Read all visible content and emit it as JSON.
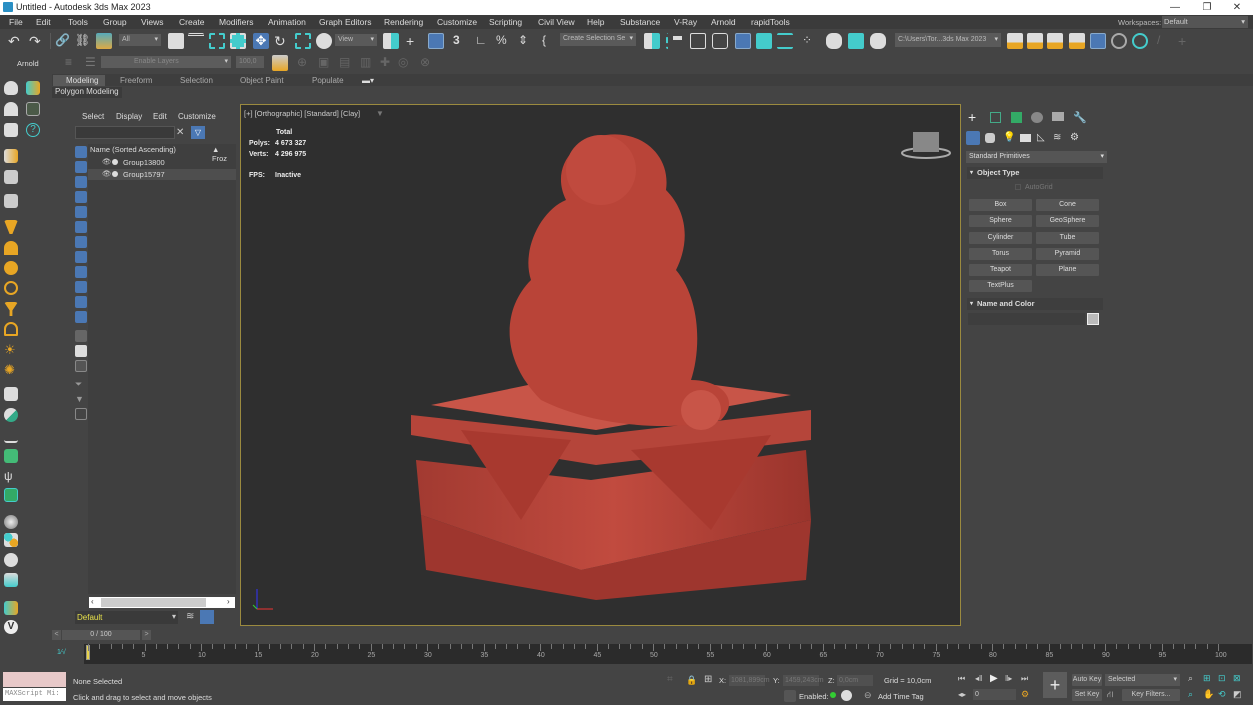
{
  "window": {
    "title": "Untitled - Autodesk 3ds Max 2023",
    "minimize": "—",
    "restore": "❐",
    "close": "✕"
  },
  "menu": [
    "File",
    "Edit",
    "Tools",
    "Group",
    "Views",
    "Create",
    "Modifiers",
    "Animation",
    "Graph Editors",
    "Rendering",
    "Customize",
    "Scripting",
    "Civil View",
    "Help",
    "Substance",
    "V-Ray",
    "Arnold",
    "rapidTools"
  ],
  "workspaces": {
    "label": "Workspaces:",
    "value": "Default"
  },
  "toolbar": {
    "selection_filter": "All",
    "ref_coord": "View",
    "named_selection": "Create Selection Se",
    "project_path": "C:\\Users\\Tor...3ds Max 2023",
    "arnold_label": "Arnold",
    "layer_dropdown": "Enable Layers",
    "layer_value": "100,0"
  },
  "ribbon": {
    "tabs": [
      "Modeling",
      "Freeform",
      "Selection",
      "Object Paint",
      "Populate"
    ],
    "active": "Modeling",
    "panel_label": "Polygon Modeling"
  },
  "scene_explorer": {
    "menu": [
      "Select",
      "Display",
      "Edit",
      "Customize"
    ],
    "search_value": "",
    "column_name": "Name (Sorted Ascending)",
    "column_frozen": "▲ Froz",
    "rows": [
      {
        "name": "Group13800"
      },
      {
        "name": "Group15797"
      }
    ],
    "layer": "Default"
  },
  "viewport": {
    "label": "[+] [Orthographic] [Standard] [Clay]",
    "stats": {
      "header": "Total",
      "polys_label": "Polys:",
      "polys": "4 673 327",
      "verts_label": "Verts:",
      "verts": "4 296 975",
      "fps_label": "FPS:",
      "fps": "Inactive"
    },
    "model_color": "#b8453a"
  },
  "command_panel": {
    "category": "Standard Primitives",
    "object_type_title": "Object Type",
    "autogrid": "AutoGrid",
    "buttons": [
      "Box",
      "Cone",
      "Sphere",
      "GeoSphere",
      "Cylinder",
      "Tube",
      "Torus",
      "Pyramid",
      "Teapot",
      "Plane",
      "TextPlus"
    ],
    "name_color_title": "Name and Color",
    "name_value": ""
  },
  "timeline": {
    "frame_display": "0 / 100",
    "current_frame": 0,
    "total_frames": 100,
    "ticks": [
      0,
      5,
      10,
      15,
      20,
      25,
      30,
      35,
      40,
      45,
      50,
      55,
      60,
      65,
      70,
      75,
      80,
      85,
      90,
      95,
      100
    ]
  },
  "status": {
    "maxscript": "MAXScript Mi:",
    "selection": "None Selected",
    "prompt": "Click and drag to select and move objects",
    "x_label": "X:",
    "x_value": "1081,899cm",
    "y_label": "Y:",
    "y_value": "1459,243cm",
    "z_label": "Z:",
    "z_value": "0,0cm",
    "grid": "Grid = 10,0cm",
    "enabled_label": "Enabled:",
    "add_time_tag": "Add Time Tag",
    "auto_key": "Auto Key",
    "set_key": "Set Key",
    "key_mode": "Selected",
    "key_filters": "Key Filters...",
    "frame_input": "0"
  }
}
